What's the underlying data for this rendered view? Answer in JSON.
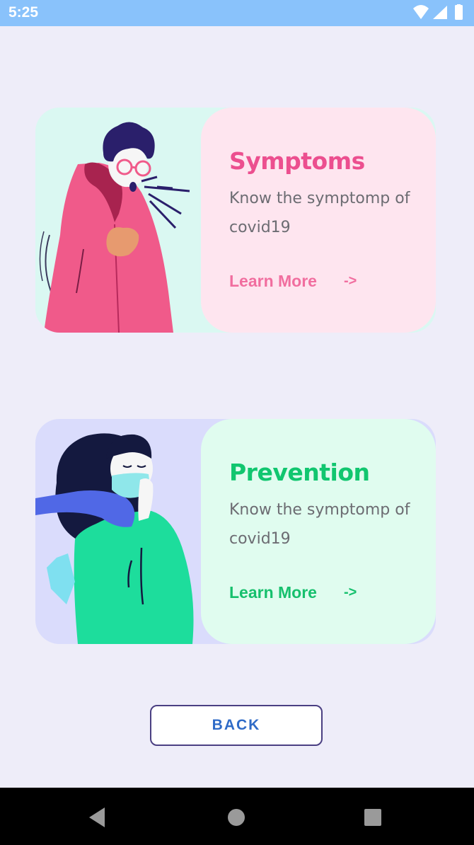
{
  "status_bar": {
    "time": "5:25",
    "icons": [
      "wifi-icon",
      "signal-icon",
      "battery-icon"
    ]
  },
  "cards": [
    {
      "title": "Symptoms",
      "description": "Know the symptomp of covid19",
      "link_label": "Learn More",
      "arrow": "->",
      "accent_color": "#ec4f8f",
      "panel_color": "#fee5ef",
      "illustration": "coughing-person-illustration"
    },
    {
      "title": "Prevention",
      "description": "Know the symptomp of covid19",
      "link_label": "Learn More",
      "arrow": "->",
      "accent_color": "#11c66f",
      "panel_color": "#e0fcef",
      "illustration": "masked-woman-illustration"
    }
  ],
  "back_button": {
    "label": "BACK"
  },
  "nav_bar": {
    "buttons": [
      "back-triangle-icon",
      "home-circle-icon",
      "recents-square-icon"
    ]
  }
}
